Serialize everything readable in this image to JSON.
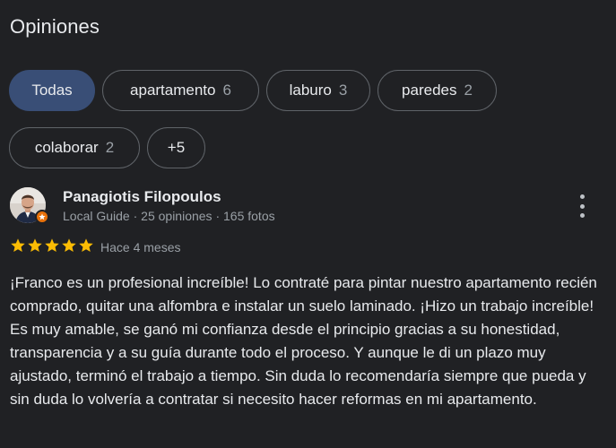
{
  "section": {
    "title": "Opiniones"
  },
  "filters": [
    {
      "label": "Todas",
      "count": "",
      "selected": true
    },
    {
      "label": "apartamento",
      "count": "6",
      "selected": false
    },
    {
      "label": "laburo",
      "count": "3",
      "selected": false
    },
    {
      "label": "paredes",
      "count": "2",
      "selected": false
    },
    {
      "label": "colaborar",
      "count": "2",
      "selected": false
    },
    {
      "label": "+5",
      "count": "",
      "selected": false
    }
  ],
  "review": {
    "author": "Panagiotis Filopoulos",
    "meta": "Local Guide · 25 opiniones · 165 fotos",
    "rating": 5,
    "time": "Hace 4 meses",
    "text": "¡Franco es un profesional increíble! Lo contraté para pintar nuestro apartamento recién comprado, quitar una alfombra e instalar un suelo laminado. ¡Hizo un trabajo increíble! Es muy amable, se ganó mi confianza desde el principio gracias a su honestidad, transparencia y a su guía durante todo el proceso. Y aunque le di un plazo muy ajustado, terminó el trabajo a tiempo. Sin duda lo recomendaría siempre que pueda y sin duda lo volvería a contratar si necesito hacer reformas en mi apartamento."
  },
  "icons": {
    "star": "star-icon",
    "more": "more-vert-icon",
    "badge": "local-guide-badge-icon"
  },
  "colors": {
    "background": "#202124",
    "chip_selected": "#394e76",
    "chip_border": "#5f6368",
    "star": "#fbbc04",
    "badge": "#e8710a",
    "muted_text": "#9aa0a6"
  }
}
